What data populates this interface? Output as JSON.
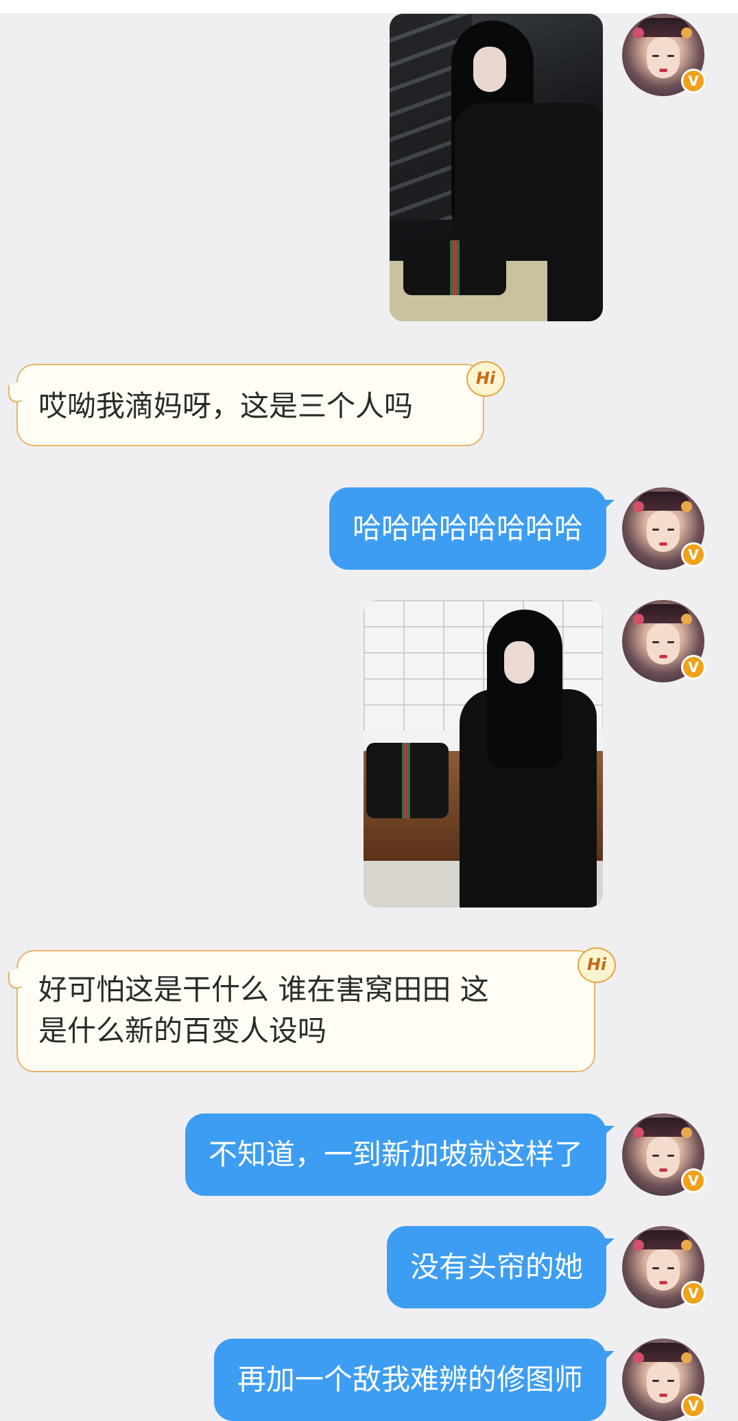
{
  "colors": {
    "background": "#efeff1",
    "outgoing_bubble": "#3d9df2",
    "incoming_bubble": "#fffdf4",
    "incoming_border": "#e6b56a",
    "verified_badge": "#f0a11a"
  },
  "messages": [
    {
      "side": "right",
      "type": "image",
      "icon": "photo-woman-black-coat-airport-cart"
    },
    {
      "side": "left",
      "type": "text",
      "text": "哎呦我滴妈呀，这是三个人吗",
      "badge": "Hi"
    },
    {
      "side": "right",
      "type": "text",
      "text": "哈哈哈哈哈哈哈哈"
    },
    {
      "side": "right",
      "type": "image",
      "icon": "photo-woman-black-outfit-bench"
    },
    {
      "side": "left",
      "type": "text",
      "lines": [
        "好可怕这是干什么 谁在害窝田田 这",
        "是什么新的百变人设吗"
      ],
      "badge": "Hi"
    },
    {
      "side": "right",
      "type": "text",
      "text": "不知道，一到新加坡就这样了"
    },
    {
      "side": "right",
      "type": "text",
      "text": "没有头帘的她"
    },
    {
      "side": "right",
      "type": "text",
      "text": "再加一个敌我难辨的修图师"
    }
  ],
  "avatar": {
    "badge": "V"
  }
}
